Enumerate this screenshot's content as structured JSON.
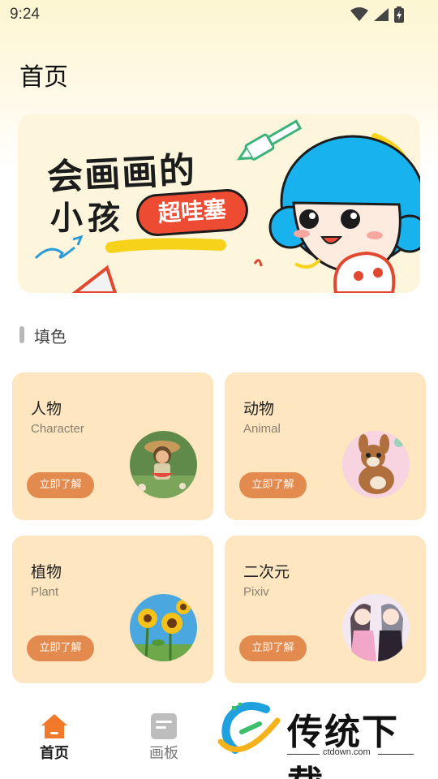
{
  "status_bar": {
    "time": "9:24"
  },
  "page": {
    "title": "首页"
  },
  "banner": {
    "title_line1": "会画画的",
    "title_line2": "小孩",
    "tag": "超哇塞"
  },
  "section": {
    "title": "填色"
  },
  "categories": [
    {
      "title": "人物",
      "subtitle": "Character",
      "button": "立即了解"
    },
    {
      "title": "动物",
      "subtitle": "Animal",
      "button": "立即了解"
    },
    {
      "title": "植物",
      "subtitle": "Plant",
      "button": "立即了解"
    },
    {
      "title": "二次元",
      "subtitle": "Pixiv",
      "button": "立即了解"
    }
  ],
  "bottom_nav": [
    {
      "label": "首页",
      "icon": "home-icon",
      "active": true
    },
    {
      "label": "画板",
      "icon": "board-icon",
      "active": false
    }
  ],
  "watermark": {
    "text": "传统下载",
    "url": "ctdown.com"
  },
  "colors": {
    "card_bg": "#fde6c0",
    "button": "#e38a4f",
    "accent_home": "#f07a2a"
  }
}
